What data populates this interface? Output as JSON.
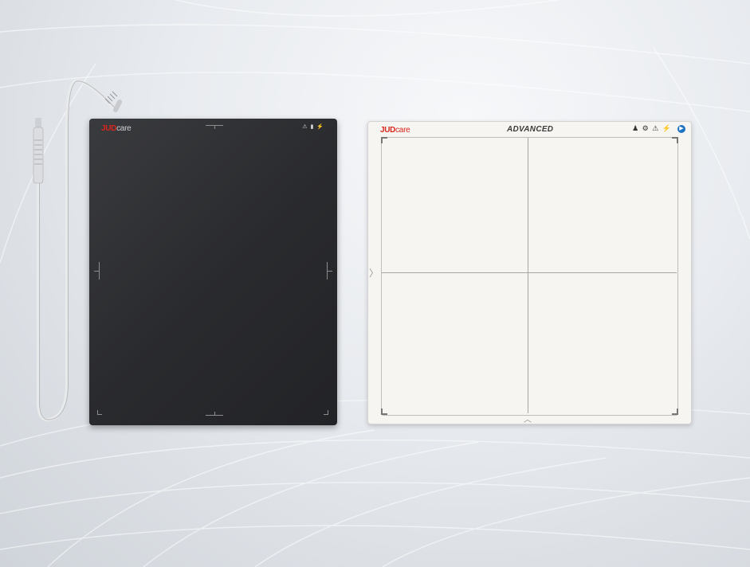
{
  "colors": {
    "background": "#e8ebef",
    "dark_panel": "#2a2b2e",
    "white_panel": "#f6f5f1",
    "brand_red": "#d9261c",
    "info_blue": "#1d72c2"
  },
  "dark_detector": {
    "brand_red": "JUD",
    "brand_rest": "care",
    "status_icons": "⚠ ▮ ⚡",
    "icons": [
      "warning-icon",
      "battery-icon",
      "power-icon"
    ]
  },
  "white_detector": {
    "brand_red": "JUD",
    "brand_rest": "care",
    "model_name": "ADVANCED",
    "status_icons": "♟ ⚙ ⚠ ⚡",
    "info_glyph": "▶",
    "side_arrow": "〉",
    "bottom_arrow": "︿",
    "icons": [
      "person-icon",
      "gear-icon",
      "warning-icon",
      "power-icon",
      "info-icon"
    ]
  },
  "cable": {
    "icon": "cable-connector-icon"
  }
}
